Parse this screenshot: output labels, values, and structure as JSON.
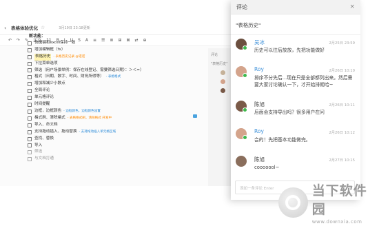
{
  "doc": {
    "title": "表格体验优化",
    "time": "3月19日 23:18更新",
    "toolbar": [
      "↶",
      "↷",
      "✎",
      "正文",
      "11",
      "B",
      "I",
      "U",
      "S",
      "A",
      "≡",
      "☰",
      "≣",
      "⊞",
      "⊠",
      "⇄",
      "⊕"
    ],
    "heading": "新功能：",
    "tasks": [
      {
        "text": "快捷键和excel保持一致",
        "note": "",
        "done": false,
        "hl": false
      },
      {
        "text": "增加编辑框（fx）",
        "note": "",
        "done": false,
        "hl": false
      },
      {
        "text": "表格历史",
        "note": "- 表格历史记录 @诺诺",
        "done": false,
        "hl": true
      },
      {
        "text": "下拉菜单选项",
        "note": "",
        "done": false,
        "hl": false
      },
      {
        "text": "筛选（用户场景举例：保存在线登记、需要筛选日期）：＞＜=）",
        "note": "",
        "done": false,
        "hl": false
      },
      {
        "text": "格式（日期、数字、时间、财务所得等）",
        "note": "- 表格格式",
        "done": false,
        "hl": false
      },
      {
        "text": "增加和减少小数点",
        "note": "",
        "done": false,
        "hl": false
      },
      {
        "text": "全局评论",
        "note": "",
        "done": false,
        "hl": false
      },
      {
        "text": "单元格评论",
        "note": "",
        "done": false,
        "hl": false
      },
      {
        "text": "时间提醒",
        "note": "",
        "done": false,
        "hl": false
      },
      {
        "text": "边框，边框颜色",
        "note": "- 边框颜色，边框颜色设置",
        "done": false,
        "hl": false
      },
      {
        "text": "格式刷、清除格式",
        "note": "- 表格格式刷，清除格式 开发中",
        "done": false,
        "hl": false
      },
      {
        "text": "导入、命文档",
        "note": "",
        "done": false,
        "hl": false
      },
      {
        "text": "支持拖动插入、拖动替换",
        "note": "- 支持拖动插入单元格区域",
        "done": false,
        "hl": false
      },
      {
        "text": "查找、替换",
        "note": "",
        "done": false,
        "hl": false
      },
      {
        "text": "导入",
        "note": "",
        "done": false,
        "hl": false
      },
      {
        "text": "筛选",
        "note": "",
        "done": true,
        "hl": false
      },
      {
        "text": "与文档打通",
        "note": "",
        "done": true,
        "hl": false
      }
    ],
    "sidebar_label": "评论",
    "sidebar_quote": "\"表格历史\""
  },
  "panel": {
    "header": "评论",
    "close": "×",
    "quote": "\"表格历史\"",
    "input_placeholder": "添加一条评论 Enter",
    "comments": [
      {
        "name": "吴冰",
        "time": "2月25日 23:59",
        "text": "历史可以往后放放，先把功能做好",
        "name_color": "#3b8fd9",
        "avatar_color": "#6b4f3f",
        "online": true
      },
      {
        "name": "Roy",
        "time": "2月26日 10:10",
        "text": "排序不分先后...现在只是全部都列出来。然后需要大家讨论确认一下，才开始排期哈~",
        "name_color": "#3b8fd9",
        "avatar_color": "#d4a48c",
        "online": true
      },
      {
        "name": "陈旭",
        "time": "2月26日 10:11",
        "text": "后面会支持导出吗？很多用户在问",
        "name_color": "#444444",
        "avatar_color": "#7a5a48",
        "online": true
      },
      {
        "name": "Roy",
        "time": "2月26日 10:12",
        "text": "会的！先把基本功能做完。",
        "name_color": "#3b8fd9",
        "avatar_color": "#d4a48c",
        "online": true
      },
      {
        "name": "陈旭",
        "time": "2月27日 10:15",
        "text": "cooooool~",
        "name_color": "#444444",
        "avatar_color": "#8a6e5c",
        "online": false
      }
    ]
  },
  "watermark": {
    "brand": "当下软件园",
    "url": "www.downxia.com"
  }
}
